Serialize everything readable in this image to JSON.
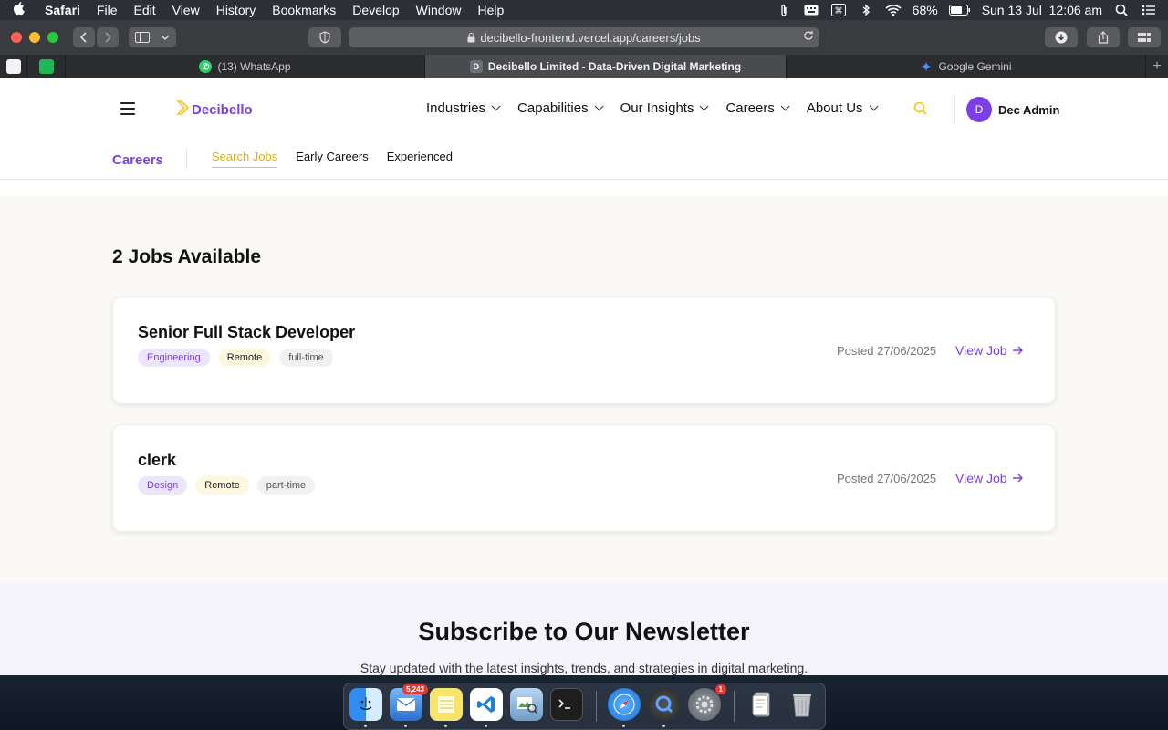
{
  "menubar": {
    "app_name": "Safari",
    "items": [
      "File",
      "Edit",
      "View",
      "History",
      "Bookmarks",
      "Develop",
      "Window",
      "Help"
    ],
    "battery": "68%",
    "datetime": "Sun 13 Jul  12:06 am"
  },
  "browser": {
    "url": "decibello-frontend.vercel.app/careers/jobs",
    "tabs": [
      {
        "label": "(13) WhatsApp",
        "favicon": "whatsapp-icon"
      },
      {
        "label": "Decibello Limited - Data-Driven Digital Marketing",
        "favicon_letter": "D"
      },
      {
        "label": "Google Gemini",
        "favicon": "gemini-icon"
      }
    ]
  },
  "site": {
    "logo_text": "Decibello",
    "nav": [
      "Industries",
      "Capabilities",
      "Our Insights",
      "Careers",
      "About Us"
    ],
    "user": {
      "initial": "D",
      "name": "Dec Admin"
    }
  },
  "subnav": {
    "title": "Careers",
    "links": [
      "Search Jobs",
      "Early Careers",
      "Experienced"
    ]
  },
  "jobs": {
    "heading": "2 Jobs Available",
    "view_label": "View Job",
    "items": [
      {
        "title": "Senior Full Stack Developer",
        "department": "Engineering",
        "location": "Remote",
        "type": "full-time",
        "posted": "Posted 27/06/2025"
      },
      {
        "title": "clerk",
        "department": "Design",
        "location": "Remote",
        "type": "part-time",
        "posted": "Posted 27/06/2025"
      }
    ]
  },
  "newsletter": {
    "title": "Subscribe to Our Newsletter",
    "subtitle": "Stay updated with the latest insights, trends, and strategies in digital marketing."
  },
  "dock": {
    "mail_badge": "5,243",
    "settings_badge": "1"
  },
  "colors": {
    "brand_purple": "#7b3fe4",
    "brand_yellow": "#f5c518"
  }
}
